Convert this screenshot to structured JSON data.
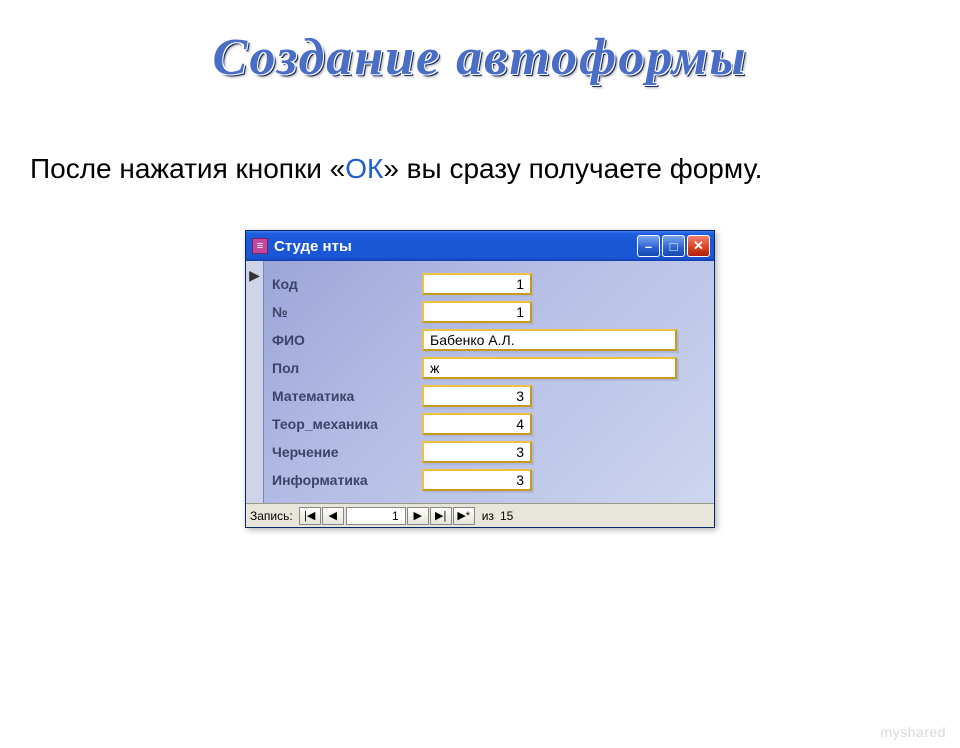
{
  "slide": {
    "title": "Создание автоформы",
    "body_before": "После нажатия кнопки «",
    "body_ok": "ОК",
    "body_after": "» вы сразу получаете форму."
  },
  "window": {
    "title": "Студе нты",
    "minimize_glyph": "–",
    "maximize_glyph": "□",
    "close_glyph": "✕"
  },
  "form": {
    "record_marker": "▶",
    "fields": [
      {
        "label": "Код",
        "value": "1",
        "w": "num"
      },
      {
        "label": "№",
        "value": "1",
        "w": "num"
      },
      {
        "label": "ФИО",
        "value": "Бабенко А.Л.",
        "w": "text"
      },
      {
        "label": "Пол",
        "value": "ж",
        "w": "text"
      },
      {
        "label": "Математика",
        "value": "3",
        "w": "num"
      },
      {
        "label": "Теор_механика",
        "value": "4",
        "w": "num"
      },
      {
        "label": "Черчение",
        "value": "3",
        "w": "num"
      },
      {
        "label": "Информатика",
        "value": "3",
        "w": "num"
      }
    ]
  },
  "nav": {
    "label": "Запись:",
    "first": "|◀",
    "prev": "◀",
    "current": "1",
    "next": "▶",
    "last": "▶|",
    "new": "▶*",
    "of_label": "из",
    "total": "15"
  },
  "watermark": "myshared"
}
